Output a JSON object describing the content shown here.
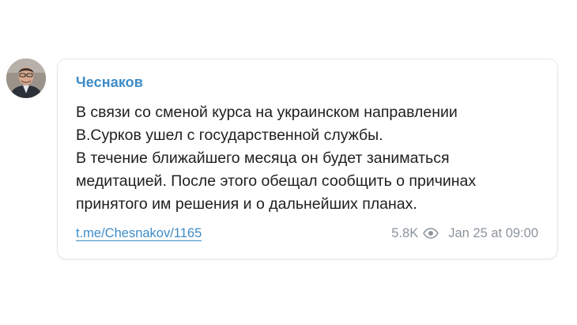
{
  "post": {
    "author": "Чеснаков",
    "avatar": "author-photo",
    "text_lines": [
      "В связи со сменой курса на украинском направлении",
      "В.Сурков ушел с государственной службы.",
      "В течение ближайшего месяца он будет заниматься",
      "медитацией. После этого обещал сообщить о причинах",
      "принятого им решения и о дальнейших планах."
    ],
    "link": "t.me/Chesnakov/1165",
    "views": "5.8K",
    "views_icon": "eye-icon",
    "date": "Jan 25 at 09:00"
  },
  "colors": {
    "accent": "#3d8cc8",
    "text": "#202020",
    "meta": "#8c949c",
    "border": "#e3e8ee"
  }
}
